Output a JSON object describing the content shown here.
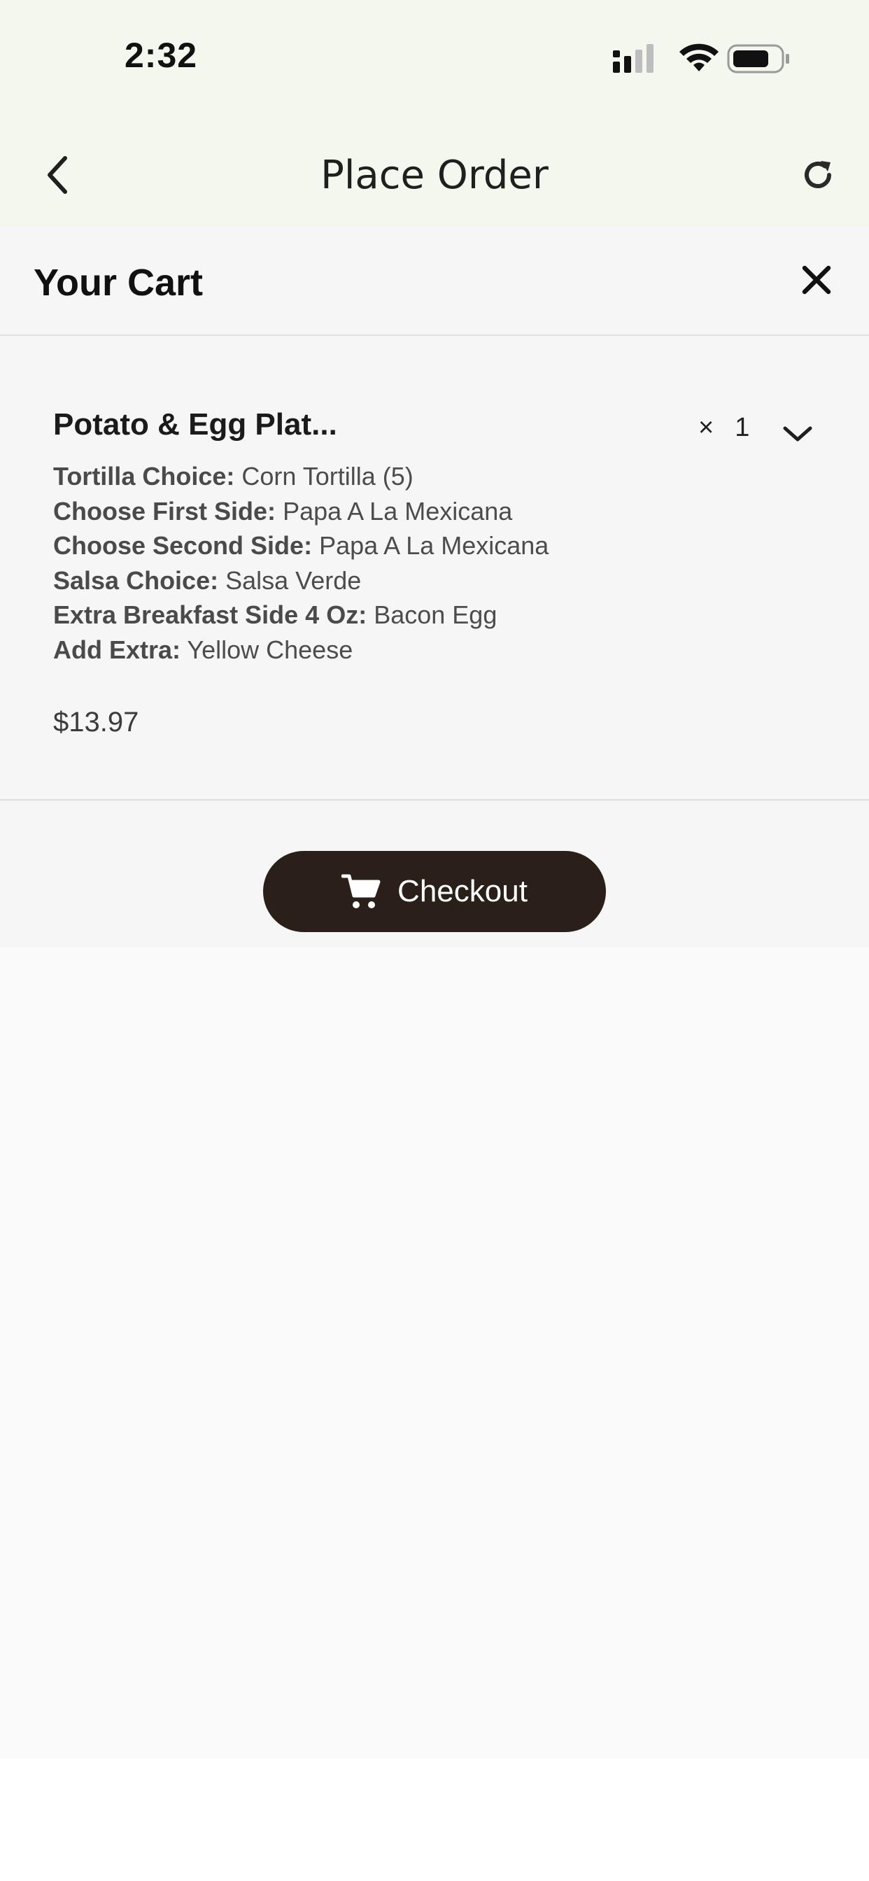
{
  "status_bar": {
    "time": "2:32"
  },
  "nav": {
    "title": "Place Order",
    "back_icon": "chevron-left-icon",
    "refresh_icon": "refresh-icon"
  },
  "cart": {
    "title": "Your Cart",
    "close_icon": "close-icon"
  },
  "item": {
    "name": "Potato & Egg Plat...",
    "qty_prefix": "×",
    "quantity": "1",
    "options": [
      {
        "label": "Tortilla Choice:",
        "value": "Corn Tortilla (5)"
      },
      {
        "label": "Choose First Side:",
        "value": "Papa A La Mexicana"
      },
      {
        "label": "Choose Second Side:",
        "value": "Papa A La Mexicana"
      },
      {
        "label": "Salsa Choice:",
        "value": "Salsa Verde"
      },
      {
        "label": "Extra Breakfast Side 4 Oz:",
        "value": "Bacon Egg"
      },
      {
        "label": "Add Extra:",
        "value": "Yellow Cheese"
      }
    ],
    "price": "$13.97"
  },
  "checkout": {
    "label": "Checkout",
    "icon": "cart-icon"
  },
  "colors": {
    "header_bg": "#f3f7ee",
    "button_bg": "#2b2019",
    "page_bg": "#fafafa"
  }
}
